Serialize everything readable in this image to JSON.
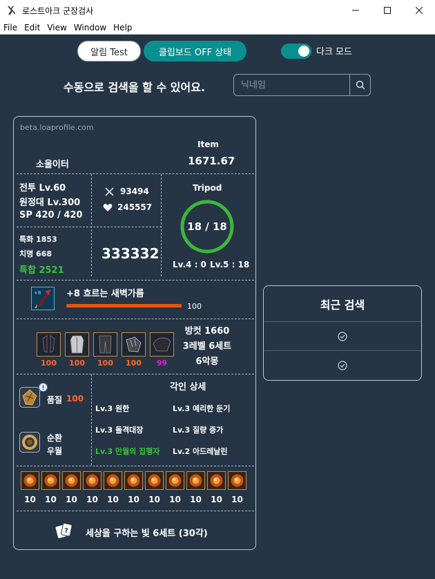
{
  "window": {
    "title": "로스트아크 군장검사",
    "minimize": "—",
    "maximize": "☐",
    "close": "✕"
  },
  "menu": [
    "File",
    "Edit",
    "View",
    "Window",
    "Help"
  ],
  "controls": {
    "alarm_test": "알림 Test",
    "clipboard": "클립보드 OFF 상태",
    "dark_mode": "다크 모드",
    "dark_mode_on": true,
    "search_hint": "수동으로 검색을 할 수 있어요.",
    "search_placeholder": "닉네임"
  },
  "profile": {
    "domain": "beta.loaprofile.com",
    "class": "소울이터",
    "item_label": "Item",
    "item_level": "1671.67",
    "combat_lv": "전투 Lv.60",
    "expedition_lv": "원정대 Lv.300",
    "sp": "SP 420 / 420",
    "attack": "93494",
    "hp": "245557",
    "specialization": "특화 1853",
    "crit": "치명 668",
    "swiftness": "특합 2521",
    "combat_power": "333332",
    "tripod_label": "Tripod",
    "tripod_value": "18 / 18",
    "tripod_fraction": 1.0,
    "tripod_lv4": "Lv.4 : 0",
    "tripod_lv5": "Lv.5 : 18",
    "weapon_name": "+8 흐르는 새벽가름",
    "weapon_quality": "100",
    "weapon_quality_value": 100,
    "armor_quality": [
      "100",
      "100",
      "100",
      "100",
      "99"
    ],
    "armor_quality_colors": [
      "#ff6a2c",
      "#ff6a2c",
      "#ff6a2c",
      "#ff6a2c",
      "#e01fd0"
    ],
    "defense": "방컷 1660",
    "set_level": "3레벨 6세트",
    "set_name": "6악몽",
    "ability_stone_quality_label": "품질",
    "ability_stone_quality": "100",
    "bracelet_label_1": "순환",
    "bracelet_label_2": "우월",
    "engravings_title": "각인 상세",
    "engravings": [
      {
        "text": "Lv.3 원한",
        "color": "#ffffff"
      },
      {
        "text": "Lv.3 예리한 둔기",
        "color": "#ffffff"
      },
      {
        "text": "Lv.3 돌격대장",
        "color": "#ffffff"
      },
      {
        "text": "Lv.3 질량 증가",
        "color": "#ffffff"
      },
      {
        "text": "Lv.3 만월의 집행자",
        "color": "#39c23a"
      },
      {
        "text": "Lv.2 아드레날린",
        "color": "#ffffff"
      }
    ],
    "gems": [
      "10",
      "10",
      "10",
      "10",
      "10",
      "10",
      "10",
      "10",
      "10",
      "10",
      "10"
    ],
    "card_set": "세상을 구하는 빛 6세트 (30각)"
  },
  "recent": {
    "title": "최근 검색"
  },
  "colors": {
    "accent": "#0a8f8f",
    "background": "#263546",
    "quality_orange": "#ff6a2c",
    "green": "#39c23a"
  }
}
